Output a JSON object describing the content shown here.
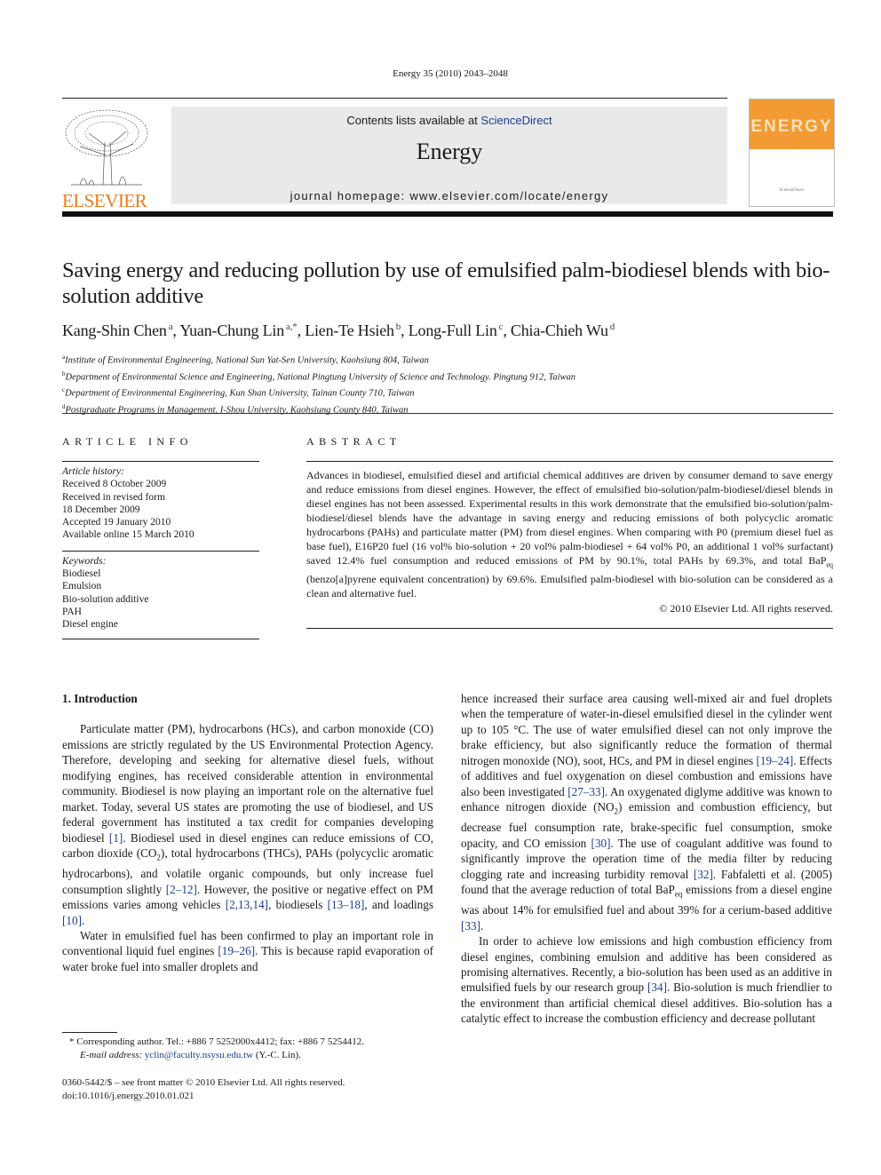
{
  "header": {
    "citation": "Energy 35 (2010) 2043–2048",
    "publisher_logo_text": "ELSEVIER",
    "contents_prefix": "Contents lists available at ",
    "contents_link": "ScienceDirect",
    "journal_name": "Energy",
    "homepage": "journal homepage: www.elsevier.com/locate/energy",
    "cover_title": "ENERGY"
  },
  "article": {
    "title": "Saving energy and reducing pollution by use of emulsified palm-biodiesel blends with bio-solution additive",
    "authors": [
      {
        "name": "Kang-Shin Chen",
        "sup": "a",
        "sep": ", "
      },
      {
        "name": "Yuan-Chung Lin",
        "sup": "a,*",
        "sep": ", "
      },
      {
        "name": "Lien-Te Hsieh",
        "sup": "b",
        "sep": ", "
      },
      {
        "name": "Long-Full Lin",
        "sup": "c",
        "sep": ", "
      },
      {
        "name": "Chia-Chieh Wu",
        "sup": "d",
        "sep": ""
      }
    ],
    "affiliations": [
      {
        "key": "a",
        "text": "Institute of Environmental Engineering, National Sun Yat-Sen University, Kaohsiung 804, Taiwan"
      },
      {
        "key": "b",
        "text": "Department of Environmental Science and Engineering, National Pingtung University of Science and Technology. Pingtung 912, Taiwan"
      },
      {
        "key": "c",
        "text": "Department of Environmental Engineering, Kun Shan University, Tainan County 710, Taiwan"
      },
      {
        "key": "d",
        "text": "Postgraduate Programs in Management, I-Shou University, Kaohsiung County 840, Taiwan"
      }
    ]
  },
  "article_info": {
    "heading": "ARTICLE INFO",
    "history_label": "Article history:",
    "history": [
      "Received 8 October 2009",
      "Received in revised form",
      "18 December 2009",
      "Accepted 19 January 2010",
      "Available online 15 March 2010"
    ],
    "keywords_label": "Keywords:",
    "keywords": [
      "Biodiesel",
      "Emulsion",
      "Bio-solution additive",
      "PAH",
      "Diesel engine"
    ]
  },
  "abstract": {
    "heading": "ABSTRACT",
    "part1": "Advances in biodiesel, emulsified diesel and artificial chemical additives are driven by consumer demand to save energy and reduce emissions from diesel engines. However, the effect of emulsified bio-solution/palm-biodiesel/diesel blends in diesel engines has not been assessed. Experimental results in this work demonstrate that the emulsified bio-solution/palm-biodiesel/diesel blends have the advantage in saving energy and reducing emissions of both polycyclic aromatic hydrocarbons (PAHs) and particulate matter (PM) from diesel engines. When comparing with P0 (premium diesel fuel as base fuel), E16P20 fuel (16 vol% bio-solution + 20 vol% palm-biodiesel + 64 vol% P0, an additional 1 vol% surfactant) saved 12.4% fuel consumption and reduced emissions of PM by 90.1%, total PAHs by 69.3%, and total BaP",
    "sub": "eq",
    "part2": " (benzo[a]pyrene equivalent concentration) by 69.6%. Emulsified palm-biodiesel with bio-solution can be considered as a clean and alternative fuel.",
    "copyright": "© 2010 Elsevier Ltd. All rights reserved."
  },
  "body": {
    "section_heading": "1.  Introduction",
    "p1": [
      {
        "t": "Particulate matter (PM), hydrocarbons (HCs), and carbon monoxide (CO) emissions are strictly regulated by the US Environmental Protection Agency. Therefore, developing and seeking for alternative diesel fuels, without modifying engines, has received considerable attention in environmental community. Biodiesel is now playing an important role on the alternative fuel market. Today, several US states are promoting the use of biodiesel, and US federal government has instituted a tax credit for companies developing biodiesel "
      },
      {
        "ref": "[1]"
      },
      {
        "t": ". Biodiesel used in diesel engines can reduce emissions of CO, carbon dioxide (CO"
      },
      {
        "sub": "2"
      },
      {
        "t": "), total hydrocarbons (THCs), PAHs (polycyclic aromatic hydrocarbons), and volatile organic compounds, but only increase fuel consumption slightly "
      },
      {
        "ref": "[2–12]"
      },
      {
        "t": ". However, the positive or negative effect on PM emissions varies among vehicles "
      },
      {
        "ref": "[2,13,14]"
      },
      {
        "t": ", biodiesels "
      },
      {
        "ref": "[13–18]"
      },
      {
        "t": ", and loadings "
      },
      {
        "ref": "[10]"
      },
      {
        "t": "."
      }
    ],
    "p2": [
      {
        "t": "Water in emulsified fuel has been confirmed to play an important role in conventional liquid fuel engines "
      },
      {
        "ref": "[19–26]"
      },
      {
        "t": ". This is because rapid evaporation of water broke fuel into smaller droplets and hence increased their surface area causing well-mixed air and fuel droplets when the temperature of water-in-diesel emulsified diesel in the cylinder went up to 105 °C. The use of water emulsified diesel can not only improve the brake efficiency, but also significantly reduce the formation of thermal nitrogen monoxide (NO), soot, HCs, and PM in diesel engines "
      },
      {
        "ref": "[19–24]"
      },
      {
        "t": ". Effects of additives and fuel oxygenation on diesel combustion and emissions have also been investigated "
      },
      {
        "ref": "[27–33]"
      },
      {
        "t": ". An oxygenated diglyme additive was known to enhance nitrogen dioxide (NO"
      },
      {
        "sub": "2"
      },
      {
        "t": ") emission and combustion efficiency, but decrease fuel consumption rate, brake-specific fuel consumption, smoke opacity, and CO emission "
      },
      {
        "ref": "[30]"
      },
      {
        "t": ". The use of coagulant additive was found to significantly improve the operation time of the media filter by reducing clogging rate and increasing turbidity removal "
      },
      {
        "ref": "[32]"
      },
      {
        "t": ". Fabfaletti et al. (2005) found that the average reduction of total BaP"
      },
      {
        "sub": "eq"
      },
      {
        "t": " emissions from a diesel engine was about 14% for emulsified fuel and about 39% for a cerium-based additive "
      },
      {
        "ref": "[33]"
      },
      {
        "t": "."
      }
    ],
    "p3": [
      {
        "t": "In order to achieve low emissions and high combustion efficiency from diesel engines, combining emulsion and additive has been considered as promising alternatives. Recently, a bio-solution has been used as an additive in emulsified fuels by our research group "
      },
      {
        "ref": "[34]"
      },
      {
        "t": ". Bio-solution is much friendlier to the environment than artificial chemical diesel additives. Bio-solution has a catalytic effect to increase the combustion efficiency and decrease pollutant"
      }
    ]
  },
  "footnote": {
    "star_line": "* Corresponding author. Tel.: +886 7 5252000x4412; fax: +886 7 5254412.",
    "email_label": "E-mail address: ",
    "email": "yclin@faculty.nsysu.edu.tw",
    "email_suffix": " (Y.-C. Lin)."
  },
  "front_matter": {
    "issn_line": "0360-5442/$ – see front matter © 2010 Elsevier Ltd. All rights reserved.",
    "doi": "doi:10.1016/j.energy.2010.01.021"
  }
}
